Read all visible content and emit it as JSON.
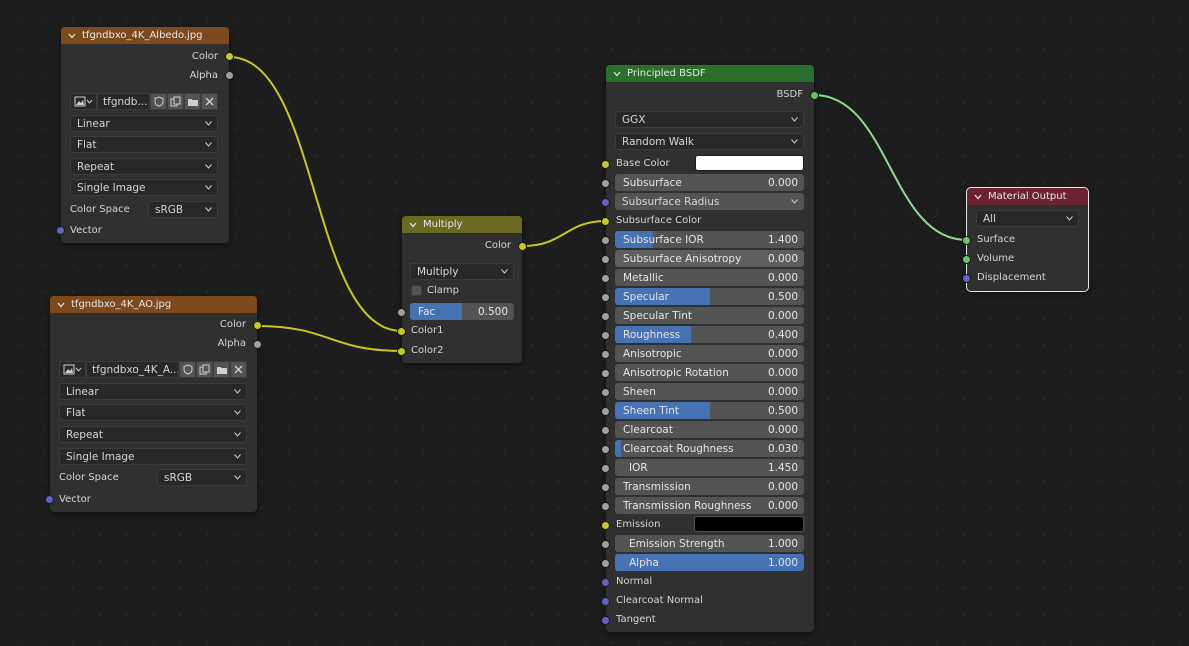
{
  "colors": {
    "image_header": "#7d4a1e",
    "mix_header": "#6a6a22",
    "shader_header": "#2b6f2c",
    "output_header": "#6c2330",
    "socket_color": "#c7c729",
    "socket_float": "#a1a1a1",
    "socket_vector": "#6363c7",
    "socket_shader": "#63c763",
    "slider_fill": "#4772b3"
  },
  "albedo_node": {
    "title": "tfgndbxo_4K_Albedo.jpg",
    "out_color": "Color",
    "out_alpha": "Alpha",
    "image_name": "tfgndb...",
    "interpolation": "Linear",
    "projection": "Flat",
    "extension": "Repeat",
    "source": "Single Image",
    "color_space_label": "Color Space",
    "color_space": "sRGB",
    "in_vector": "Vector"
  },
  "ao_node": {
    "title": "tfgndbxo_4K_AO.jpg",
    "out_color": "Color",
    "out_alpha": "Alpha",
    "image_name": "tfgndbxo_4K_A...",
    "interpolation": "Linear",
    "projection": "Flat",
    "extension": "Repeat",
    "source": "Single Image",
    "color_space_label": "Color Space",
    "color_space": "sRGB",
    "in_vector": "Vector"
  },
  "multiply_node": {
    "title": "Multiply",
    "out_color": "Color",
    "blend_mode": "Multiply",
    "clamp_label": "Clamp",
    "fac_label": "Fac",
    "fac_value": "0.500",
    "fac_fraction": 0.5,
    "in_color1": "Color1",
    "in_color2": "Color2"
  },
  "bsdf_node": {
    "title": "Principled BSDF",
    "out_bsdf": "BSDF",
    "distribution": "GGX",
    "subsurface_method": "Random Walk",
    "base_color_label": "Base Color",
    "base_color": "#ffffff",
    "subsurface_radius_label": "Subsurface Radius",
    "subsurface_color_label": "Subsurface Color",
    "emission_label": "Emission",
    "emission_color": "#000000",
    "normal_label": "Normal",
    "clearcoat_normal_label": "Clearcoat Normal",
    "tangent_label": "Tangent",
    "subsurface": {
      "label": "Subsurface",
      "value": "0.000",
      "fraction": 0
    },
    "subsurface_ior": {
      "label": "Subsurface IOR",
      "value": "1.400",
      "fraction": 0.2
    },
    "subsurface_anisotropy": {
      "label": "Subsurface Anisotropy",
      "value": "0.000",
      "fraction": 0
    },
    "metallic": {
      "label": "Metallic",
      "value": "0.000",
      "fraction": 0
    },
    "specular": {
      "label": "Specular",
      "value": "0.500",
      "fraction": 0.5
    },
    "specular_tint": {
      "label": "Specular Tint",
      "value": "0.000",
      "fraction": 0
    },
    "roughness": {
      "label": "Roughness",
      "value": "0.400",
      "fraction": 0.4
    },
    "anisotropic": {
      "label": "Anisotropic",
      "value": "0.000",
      "fraction": 0
    },
    "anisotropic_rotation": {
      "label": "Anisotropic Rotation",
      "value": "0.000",
      "fraction": 0
    },
    "sheen": {
      "label": "Sheen",
      "value": "0.000",
      "fraction": 0
    },
    "sheen_tint": {
      "label": "Sheen Tint",
      "value": "0.500",
      "fraction": 0.5
    },
    "clearcoat": {
      "label": "Clearcoat",
      "value": "0.000",
      "fraction": 0
    },
    "clearcoat_roughness": {
      "label": "Clearcoat Roughness",
      "value": "0.030",
      "fraction": 0.03
    },
    "ior": {
      "label": "IOR",
      "value": "1.450",
      "fraction": 0
    },
    "transmission": {
      "label": "Transmission",
      "value": "0.000",
      "fraction": 0
    },
    "transmission_roughness": {
      "label": "Transmission Roughness",
      "value": "0.000",
      "fraction": 0
    },
    "emission_strength": {
      "label": "Emission Strength",
      "value": "1.000",
      "fraction": 0
    },
    "alpha": {
      "label": "Alpha",
      "value": "1.000",
      "fraction": 1
    }
  },
  "output_node": {
    "title": "Material Output",
    "target": "All",
    "in_surface": "Surface",
    "in_volume": "Volume",
    "in_displacement": "Displacement"
  }
}
